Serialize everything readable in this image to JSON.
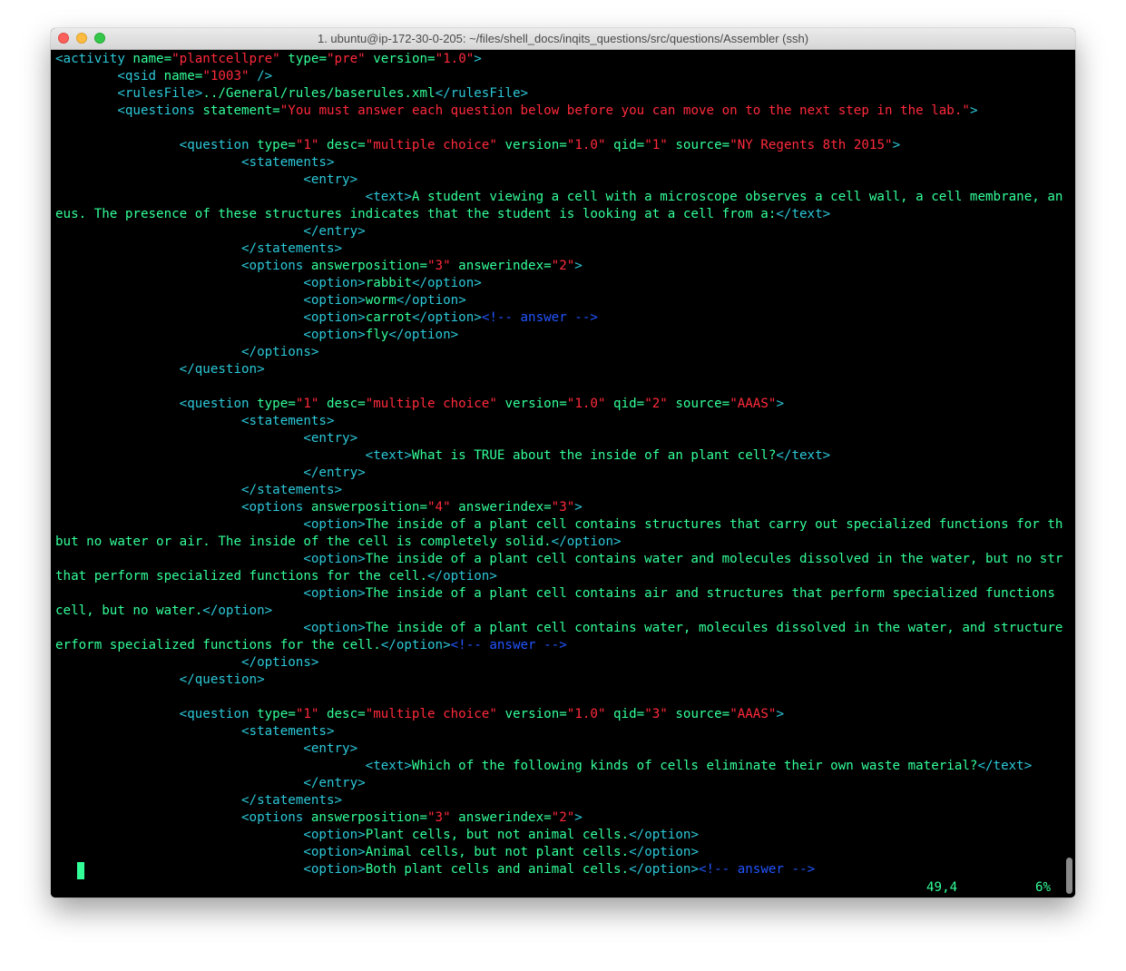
{
  "window": {
    "title": "1. ubuntu@ip-172-30-0-205: ~/files/shell_docs/inqits_questions/src/questions/Assembler (ssh)"
  },
  "colors": {
    "tag": "#2cc8d8",
    "attr": "#33ff99",
    "value": "#ff2a3c",
    "text": "#33ff99",
    "comment": "#2255ff",
    "background": "#000000"
  },
  "editor": {
    "lines": [
      [
        [
          "tag",
          "<activity "
        ],
        [
          "attr",
          "name="
        ],
        [
          "val",
          "\"plantcellpre\""
        ],
        [
          "attr",
          " type="
        ],
        [
          "val",
          "\"pre\""
        ],
        [
          "attr",
          " version="
        ],
        [
          "val",
          "\"1.0\""
        ],
        [
          "tag",
          ">"
        ]
      ],
      [
        [
          "txt",
          "        "
        ],
        [
          "tag",
          "<qsid "
        ],
        [
          "attr",
          "name="
        ],
        [
          "val",
          "\"1003\""
        ],
        [
          "tag",
          " />"
        ]
      ],
      [
        [
          "txt",
          "        "
        ],
        [
          "tag",
          "<rulesFile>"
        ],
        [
          "txt",
          "../General/rules/baserules.xml"
        ],
        [
          "tag",
          "</rulesFile>"
        ]
      ],
      [
        [
          "txt",
          "        "
        ],
        [
          "tag",
          "<questions "
        ],
        [
          "attr",
          "statement="
        ],
        [
          "val",
          "\"You must answer each question below before you can move on to the next step in the lab.\""
        ],
        [
          "tag",
          ">"
        ]
      ],
      [],
      [
        [
          "txt",
          "                "
        ],
        [
          "tag",
          "<question "
        ],
        [
          "attr",
          "type="
        ],
        [
          "val",
          "\"1\""
        ],
        [
          "attr",
          " desc="
        ],
        [
          "val",
          "\"multiple choice\""
        ],
        [
          "attr",
          " version="
        ],
        [
          "val",
          "\"1.0\""
        ],
        [
          "attr",
          " qid="
        ],
        [
          "val",
          "\"1\""
        ],
        [
          "attr",
          " source="
        ],
        [
          "val",
          "\"NY Regents 8th 2015\""
        ],
        [
          "tag",
          ">"
        ]
      ],
      [
        [
          "txt",
          "                        "
        ],
        [
          "tag",
          "<statements>"
        ]
      ],
      [
        [
          "txt",
          "                                "
        ],
        [
          "tag",
          "<entry>"
        ]
      ],
      [
        [
          "txt",
          "                                        "
        ],
        [
          "tag",
          "<text>"
        ],
        [
          "txt",
          "A student viewing a cell with a microscope observes a cell wall, a cell membrane, and a nucl"
        ]
      ],
      [
        [
          "txt",
          "eus. The presence of these structures indicates that the student is looking at a cell from a:"
        ],
        [
          "tag",
          "</text>"
        ]
      ],
      [
        [
          "txt",
          "                                "
        ],
        [
          "tag",
          "</entry>"
        ]
      ],
      [
        [
          "txt",
          "                        "
        ],
        [
          "tag",
          "</statements>"
        ]
      ],
      [
        [
          "txt",
          "                        "
        ],
        [
          "tag",
          "<options "
        ],
        [
          "attr",
          "answerposition="
        ],
        [
          "val",
          "\"3\""
        ],
        [
          "attr",
          " answerindex="
        ],
        [
          "val",
          "\"2\""
        ],
        [
          "tag",
          ">"
        ]
      ],
      [
        [
          "txt",
          "                                "
        ],
        [
          "tag",
          "<option>"
        ],
        [
          "txt",
          "rabbit"
        ],
        [
          "tag",
          "</option>"
        ]
      ],
      [
        [
          "txt",
          "                                "
        ],
        [
          "tag",
          "<option>"
        ],
        [
          "txt",
          "worm"
        ],
        [
          "tag",
          "</option>"
        ]
      ],
      [
        [
          "txt",
          "                                "
        ],
        [
          "tag",
          "<option>"
        ],
        [
          "txt",
          "carrot"
        ],
        [
          "tag",
          "</option>"
        ],
        [
          "cmt",
          "<!-- answer -->"
        ]
      ],
      [
        [
          "txt",
          "                                "
        ],
        [
          "tag",
          "<option>"
        ],
        [
          "txt",
          "fly"
        ],
        [
          "tag",
          "</option>"
        ]
      ],
      [
        [
          "txt",
          "                        "
        ],
        [
          "tag",
          "</options>"
        ]
      ],
      [
        [
          "txt",
          "                "
        ],
        [
          "tag",
          "</question>"
        ]
      ],
      [],
      [
        [
          "txt",
          "                "
        ],
        [
          "tag",
          "<question "
        ],
        [
          "attr",
          "type="
        ],
        [
          "val",
          "\"1\""
        ],
        [
          "attr",
          " desc="
        ],
        [
          "val",
          "\"multiple choice\""
        ],
        [
          "attr",
          " version="
        ],
        [
          "val",
          "\"1.0\""
        ],
        [
          "attr",
          " qid="
        ],
        [
          "val",
          "\"2\""
        ],
        [
          "attr",
          " source="
        ],
        [
          "val",
          "\"AAAS\""
        ],
        [
          "tag",
          ">"
        ]
      ],
      [
        [
          "txt",
          "                        "
        ],
        [
          "tag",
          "<statements>"
        ]
      ],
      [
        [
          "txt",
          "                                "
        ],
        [
          "tag",
          "<entry>"
        ]
      ],
      [
        [
          "txt",
          "                                        "
        ],
        [
          "tag",
          "<text>"
        ],
        [
          "txt",
          "What is TRUE about the inside of an plant cell?"
        ],
        [
          "tag",
          "</text>"
        ]
      ],
      [
        [
          "txt",
          "                                "
        ],
        [
          "tag",
          "</entry>"
        ]
      ],
      [
        [
          "txt",
          "                        "
        ],
        [
          "tag",
          "</statements>"
        ]
      ],
      [
        [
          "txt",
          "                        "
        ],
        [
          "tag",
          "<options "
        ],
        [
          "attr",
          "answerposition="
        ],
        [
          "val",
          "\"4\""
        ],
        [
          "attr",
          " answerindex="
        ],
        [
          "val",
          "\"3\""
        ],
        [
          "tag",
          ">"
        ]
      ],
      [
        [
          "txt",
          "                                "
        ],
        [
          "tag",
          "<option>"
        ],
        [
          "txt",
          "The inside of a plant cell contains structures that carry out specialized functions for the cell,"
        ]
      ],
      [
        [
          "txt",
          "but no water or air. The inside of the cell is completely solid."
        ],
        [
          "tag",
          "</option>"
        ]
      ],
      [
        [
          "txt",
          "                                "
        ],
        [
          "tag",
          "<option>"
        ],
        [
          "txt",
          "The inside of a plant cell contains water and molecules dissolved in the water, but no structures"
        ]
      ],
      [
        [
          "txt",
          "that perform specialized functions for the cell."
        ],
        [
          "tag",
          "</option>"
        ]
      ],
      [
        [
          "txt",
          "                                "
        ],
        [
          "tag",
          "<option>"
        ],
        [
          "txt",
          "The inside of a plant cell contains air and structures that perform specialized functions for the"
        ]
      ],
      [
        [
          "txt",
          "cell, but no water."
        ],
        [
          "tag",
          "</option>"
        ]
      ],
      [
        [
          "txt",
          "                                "
        ],
        [
          "tag",
          "<option>"
        ],
        [
          "txt",
          "The inside of a plant cell contains water, molecules dissolved in the water, and structures that p"
        ]
      ],
      [
        [
          "txt",
          "erform specialized functions for the cell."
        ],
        [
          "tag",
          "</option>"
        ],
        [
          "cmt",
          "<!-- answer -->"
        ]
      ],
      [
        [
          "txt",
          "                        "
        ],
        [
          "tag",
          "</options>"
        ]
      ],
      [
        [
          "txt",
          "                "
        ],
        [
          "tag",
          "</question>"
        ]
      ],
      [],
      [
        [
          "txt",
          "                "
        ],
        [
          "tag",
          "<question "
        ],
        [
          "attr",
          "type="
        ],
        [
          "val",
          "\"1\""
        ],
        [
          "attr",
          " desc="
        ],
        [
          "val",
          "\"multiple choice\""
        ],
        [
          "attr",
          " version="
        ],
        [
          "val",
          "\"1.0\""
        ],
        [
          "attr",
          " qid="
        ],
        [
          "val",
          "\"3\""
        ],
        [
          "attr",
          " source="
        ],
        [
          "val",
          "\"AAAS\""
        ],
        [
          "tag",
          ">"
        ]
      ],
      [
        [
          "txt",
          "                        "
        ],
        [
          "tag",
          "<statements>"
        ]
      ],
      [
        [
          "txt",
          "                                "
        ],
        [
          "tag",
          "<entry>"
        ]
      ],
      [
        [
          "txt",
          "                                        "
        ],
        [
          "tag",
          "<text>"
        ],
        [
          "txt",
          "Which of the following kinds of cells eliminate their own waste material?"
        ],
        [
          "tag",
          "</text>"
        ]
      ],
      [
        [
          "txt",
          "                                "
        ],
        [
          "tag",
          "</entry>"
        ]
      ],
      [
        [
          "txt",
          "                        "
        ],
        [
          "tag",
          "</statements>"
        ]
      ],
      [
        [
          "txt",
          "                        "
        ],
        [
          "tag",
          "<options "
        ],
        [
          "attr",
          "answerposition="
        ],
        [
          "val",
          "\"3\""
        ],
        [
          "attr",
          " answerindex="
        ],
        [
          "val",
          "\"2\""
        ],
        [
          "tag",
          ">"
        ]
      ],
      [
        [
          "txt",
          "                                "
        ],
        [
          "tag",
          "<option>"
        ],
        [
          "txt",
          "Plant cells, but not animal cells."
        ],
        [
          "tag",
          "</option>"
        ]
      ],
      [
        [
          "txt",
          "                                "
        ],
        [
          "tag",
          "<option>"
        ],
        [
          "txt",
          "Animal cells, but not plant cells."
        ],
        [
          "tag",
          "</option>"
        ]
      ],
      [
        [
          "txt",
          "                                "
        ],
        [
          "tag",
          "<option>"
        ],
        [
          "txt",
          "Both plant cells and animal cells."
        ],
        [
          "tag",
          "</option>"
        ],
        [
          "cmt",
          "<!-- answer -->"
        ]
      ]
    ],
    "status": {
      "position": "49,4",
      "percent": "6%"
    }
  }
}
